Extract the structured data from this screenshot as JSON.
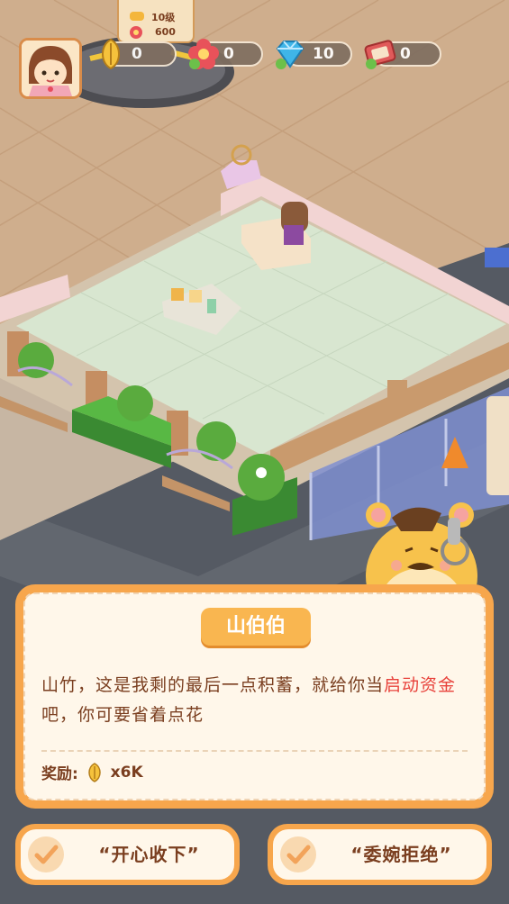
{
  "hud": {
    "level_label": "10级",
    "level_cost": "600",
    "resources": [
      {
        "name": "seed",
        "value": "0",
        "icon": "sunflower-seed-icon"
      },
      {
        "name": "flower",
        "value": "0",
        "icon": "red-flower-icon"
      },
      {
        "name": "diamond",
        "value": "10",
        "icon": "diamond-icon"
      },
      {
        "name": "ticket",
        "value": "0",
        "icon": "ticket-icon"
      }
    ]
  },
  "dialog": {
    "speaker": "山伯伯",
    "text_before": "山竹，这是我剩的最后一点积蓄，就给你当",
    "text_highlight": "启动资金",
    "text_after": "吧，你可要省着点花",
    "reward_label": "奖励:",
    "reward_amount": "x6K",
    "highlight_color": "#e8423b"
  },
  "buttons": {
    "accept_label": "“开心收下”",
    "decline_label": "“委婉拒绝”"
  }
}
